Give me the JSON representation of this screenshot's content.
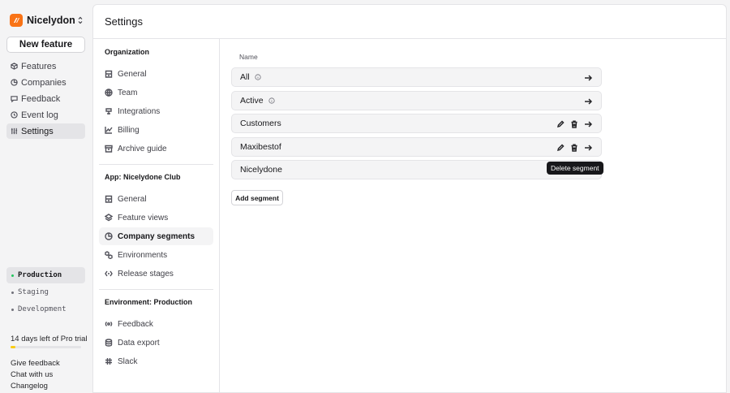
{
  "org": {
    "name": "Nicelydone C...",
    "brand_color": "#f97316"
  },
  "sidebar": {
    "new_feature_label": "New feature",
    "items": [
      {
        "label": "Features",
        "icon": "box-icon"
      },
      {
        "label": "Companies",
        "icon": "pie-chart-icon"
      },
      {
        "label": "Feedback",
        "icon": "message-icon"
      },
      {
        "label": "Event log",
        "icon": "history-icon"
      },
      {
        "label": "Settings",
        "icon": "sliders-icon",
        "active": true
      }
    ],
    "environments": [
      {
        "label": "Production",
        "active": true
      },
      {
        "label": "Staging"
      },
      {
        "label": "Development"
      }
    ],
    "trial_text": "14 days left of Pro trial",
    "trial_progress": 0.07,
    "footer_links": [
      "Give feedback",
      "Chat with us",
      "Changelog"
    ]
  },
  "panel": {
    "title": "Settings",
    "settings_nav": [
      {
        "title": "Organization",
        "items": [
          {
            "label": "General",
            "icon": "building-icon"
          },
          {
            "label": "Team",
            "icon": "globe-icon"
          },
          {
            "label": "Integrations",
            "icon": "plug-icon"
          },
          {
            "label": "Billing",
            "icon": "chart-line-icon"
          },
          {
            "label": "Archive guide",
            "icon": "archive-icon"
          }
        ]
      },
      {
        "title": "App: Nicelydone Club",
        "items": [
          {
            "label": "General",
            "icon": "building-icon"
          },
          {
            "label": "Feature views",
            "icon": "layers-icon"
          },
          {
            "label": "Company segments",
            "icon": "pie-chart-icon",
            "active": true
          },
          {
            "label": "Environments",
            "icon": "boxes-icon"
          },
          {
            "label": "Release stages",
            "icon": "stages-icon"
          }
        ]
      },
      {
        "title": "Environment: Production",
        "items": [
          {
            "label": "Feedback",
            "icon": "radio-icon"
          },
          {
            "label": "Data export",
            "icon": "database-icon"
          },
          {
            "label": "Slack",
            "icon": "slack-icon"
          }
        ]
      }
    ],
    "segments": {
      "column_header": "Name",
      "rows": [
        {
          "name": "All",
          "info": true,
          "editable": false
        },
        {
          "name": "Active",
          "info": true,
          "editable": false
        },
        {
          "name": "Customers",
          "info": false,
          "editable": true
        },
        {
          "name": "Maxibestof",
          "info": false,
          "editable": true
        },
        {
          "name": "Nicelydone",
          "info": false,
          "editable": true
        }
      ],
      "add_label": "Add segment",
      "tooltip": "Delete segment"
    }
  }
}
